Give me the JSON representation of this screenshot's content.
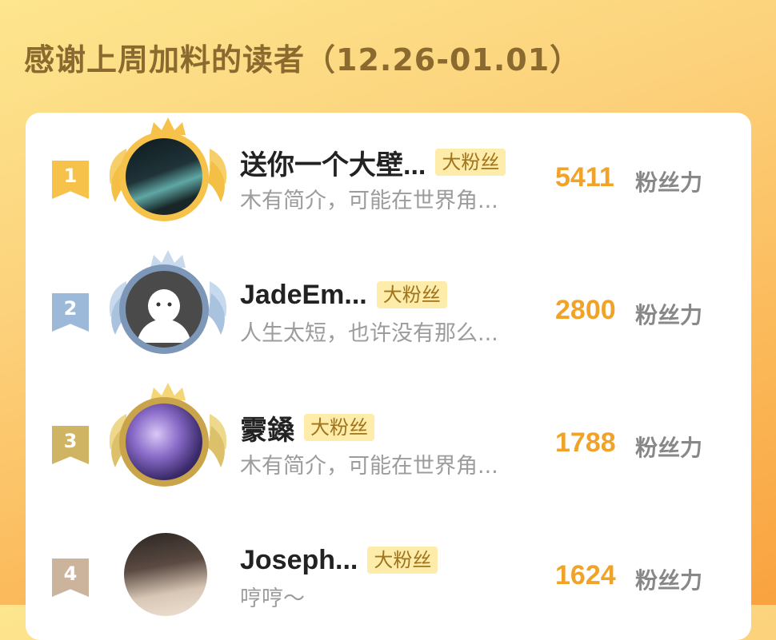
{
  "header": {
    "title": "感谢上周加料的读者（12.26-01.01）"
  },
  "score_unit": "粉丝力",
  "colors": {
    "gold_rank": "#f6c24a",
    "silver_rank": "#9db9d9",
    "bronze_rank": "#cfb463",
    "fourth_rank": "#ccb39c",
    "score": "#f0a328",
    "badge_bg": "#fdecaa"
  },
  "rows": [
    {
      "rank": "1",
      "name": "送你一个大壁...",
      "badge": "大粉丝",
      "bio": "木有简介，可能在世界角...",
      "score": "5411",
      "avatar_icon": "portrait-photo-icon"
    },
    {
      "rank": "2",
      "name": "JadeEm...",
      "badge": "大粉丝",
      "bio": "人生太短，也许没有那么...",
      "score": "2800",
      "avatar_icon": "default-ghost-avatar-icon"
    },
    {
      "rank": "3",
      "name": "霥鎟",
      "badge": "大粉丝",
      "bio": "木有简介，可能在世界角...",
      "score": "1788",
      "avatar_icon": "anime-art-avatar-icon"
    },
    {
      "rank": "4",
      "name": "Joseph...",
      "badge": "大粉丝",
      "bio": "哼哼～",
      "score": "1624",
      "avatar_icon": "anime-portrait-avatar-icon"
    }
  ]
}
